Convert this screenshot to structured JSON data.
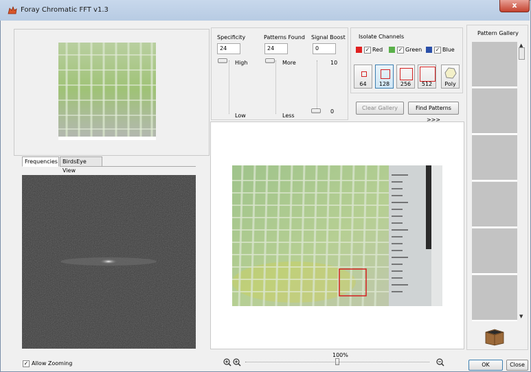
{
  "window": {
    "title": "Foray Chromatic FFT v1.3",
    "close_glyph": "x"
  },
  "tabs": [
    {
      "label": "Frequencies"
    },
    {
      "label": "BirdsEye View"
    }
  ],
  "allow_zooming": {
    "label": "Allow Zooming",
    "checked": true
  },
  "specificity": {
    "label": "Specificity",
    "value": "24",
    "high": "High",
    "low": "Low"
  },
  "patterns_found": {
    "label": "Patterns Found",
    "value": "24",
    "more": "More",
    "less": "Less"
  },
  "signal_boost": {
    "label": "Signal Boost",
    "value": "0",
    "max": "10",
    "min": "0"
  },
  "isolate": {
    "label": "Isolate Channels",
    "channels": [
      {
        "name": "Red",
        "color": "#e02020",
        "checked": true
      },
      {
        "name": "Green",
        "color": "#5ab04a",
        "checked": true
      },
      {
        "name": "Blue",
        "color": "#2a4fa8",
        "checked": true
      }
    ]
  },
  "sizes": [
    {
      "label": "64"
    },
    {
      "label": "128",
      "selected": true
    },
    {
      "label": "256"
    },
    {
      "label": "512"
    },
    {
      "label": "Poly"
    }
  ],
  "buttons": {
    "clear_gallery": "Clear Gallery",
    "find_patterns": "Find Patterns >>>",
    "ok": "OK",
    "close": "Close"
  },
  "gallery": {
    "title": "Pattern Gallery",
    "cells": 6
  },
  "zoom": {
    "value": "100%"
  }
}
